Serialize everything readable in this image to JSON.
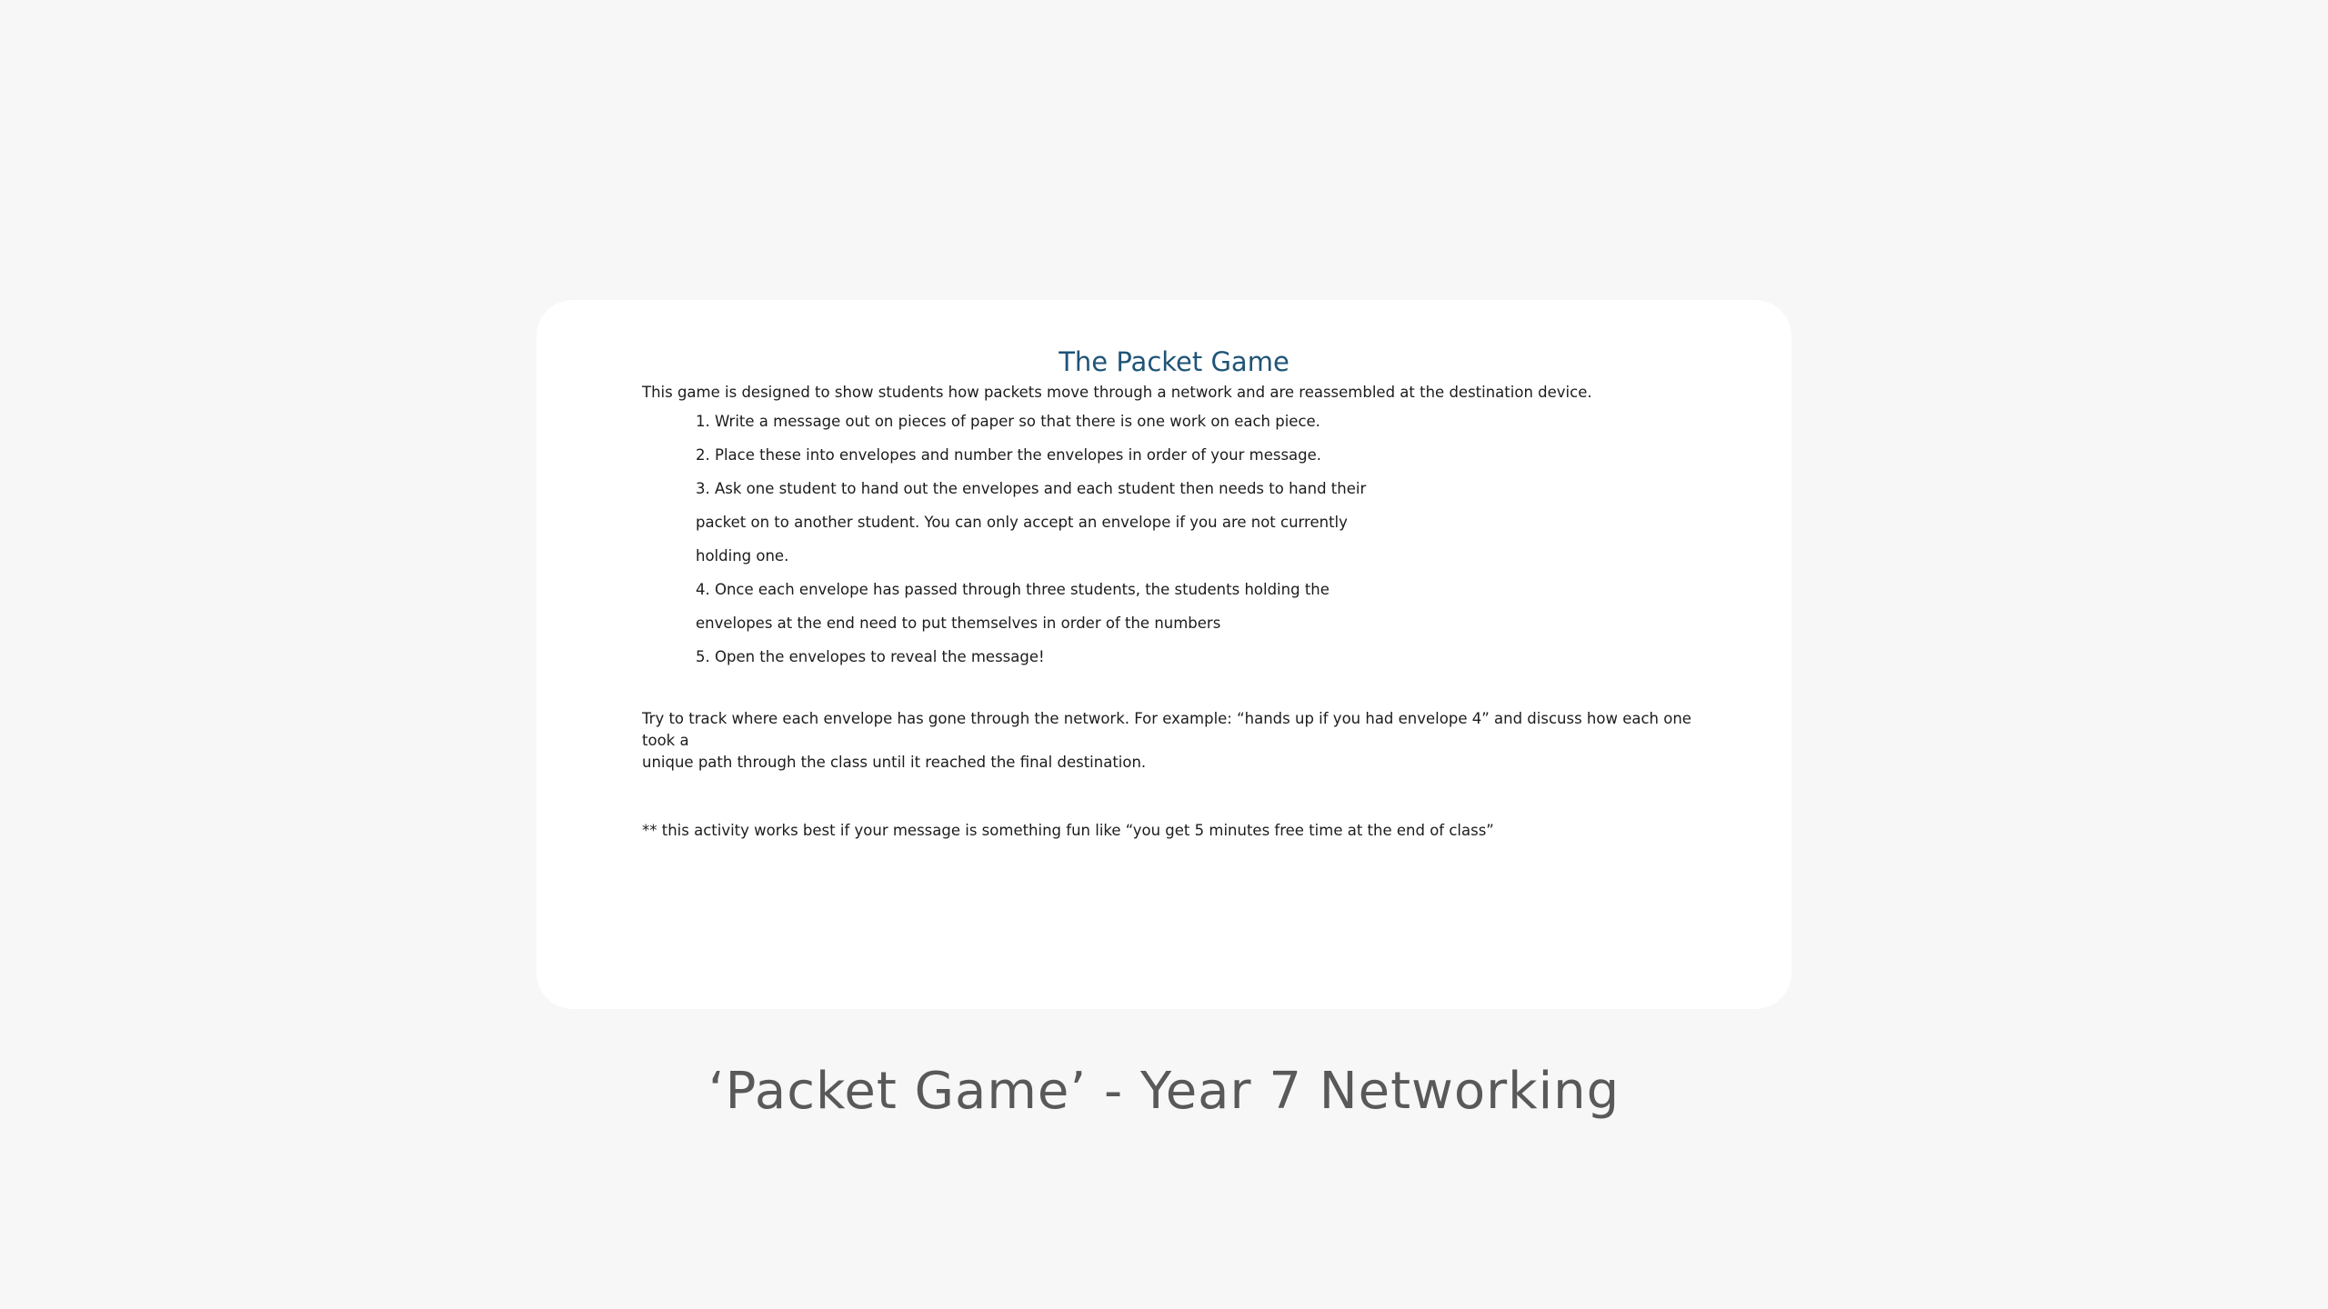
{
  "document": {
    "title": "The Packet Game",
    "intro": "This game is designed to show students how packets move through a network and are reassembled at the destination device.",
    "steps": [
      "1. Write a message out on pieces of paper so that there is one work on each piece.",
      "2. Place these into envelopes and number the envelopes in order of your message.",
      "3. Ask one student to hand out the envelopes and each student then needs to hand their",
      "packet on to another student. You can only accept an envelope if you are not currently",
      "holding one.",
      "4. Once each envelope has passed through three students, the students holding the",
      "envelopes at the end need to put themselves in order of the numbers",
      "5. Open the envelopes to reveal the message!"
    ],
    "track_line_1": "Try to track where each envelope has gone through the network. For example: “hands up if you  had envelope 4” and discuss how each one took a",
    "track_line_2": "unique path through the class until it reached the final destination.",
    "note": "** this activity works best if your message is something fun like “you get 5 minutes free time at  the end of class”"
  },
  "caption": "‘Packet Game’ - Year 7 Networking"
}
